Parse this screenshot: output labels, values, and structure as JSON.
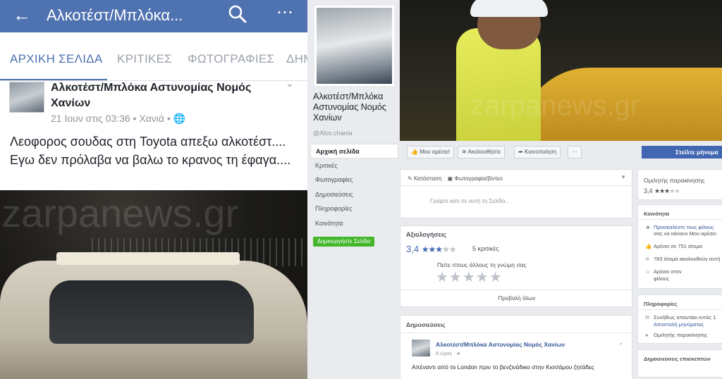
{
  "mobile": {
    "header_title": "Αλκοτέστ/Μπλόκα...",
    "tabs": [
      "ΑΡΧΙΚΗ ΣΕΛΙΔΑ",
      "ΚΡΙΤΙΚΕΣ",
      "ΦΩΤΟΓΡΑΦΙΕΣ",
      "ΔΗΜ"
    ],
    "page_name": "Αλκοτέστ/Μπλόκα Αστυνομίας Νομός Χανίων",
    "meta_date": "21 Ιουν στις 03:36",
    "meta_location": "Χανιά",
    "post_text": "Λεοφορος σουδας στη  Toyota απεξω αλκοτέστ.... Εγω δεν πρόλαβα να βαλω το κρανος τη έφαγα....",
    "photo_watermark": "zarpanews.gr",
    "accent": "#4f72b0"
  },
  "desktop": {
    "page_name": "Αλκοτέστ/Μπλόκα Αστυνομίας Νομός Χανίων",
    "handle": "@Alco.chania",
    "nav": [
      "Αρχική σελίδα",
      "Κριτικές",
      "Φωτογραφίες",
      "Δημοσιεύσεις",
      "Πληροφορίες",
      "Κοινότητα"
    ],
    "create_page": "Δημιουργήστε Σελίδα",
    "cover_watermark": "zarpanews.gr",
    "actions": {
      "like": "Μου αρέσει!",
      "follow": "Ακολουθήστε",
      "share": "Κοινοποίηση",
      "more": "···",
      "send": "Στείλτε μήνυμα"
    },
    "composer": {
      "status": "Κατάσταση",
      "photo": "Φωτογραφία/βίντεο",
      "placeholder": "Γράψτε κάτι σε αυτή τη Σελίδα..."
    },
    "reviews": {
      "title": "Αξιολογήσεις",
      "score": "3,4",
      "count": "5 κριτικές",
      "prompt": "Πείτε στους άλλους τη γνώμη σας",
      "see_all": "Προβολή όλων"
    },
    "posts": {
      "title": "Δημοσιεύσεις",
      "name": "Αλκοτέστ/Μπλόκα Αστυνομίας Νομός Χανίων",
      "time": "8 ώρες",
      "text": "Απέναντι από το London πριν το βενζινάδικο στην Κισσάμου ζητάδες"
    },
    "right": {
      "response_title": "Ομιλητής παρακίνησης",
      "response_score": "3,4",
      "community_title": "Κοινότητα",
      "invite": "Προσκαλέστε τους φίλους",
      "invite2": "σας να κάνουν Μου αρέσει",
      "likes": "Αρέσει σε 751 άτομα",
      "follows": "783 άτομα ακολουθούν αυτή",
      "friends1": "Αρέσει στον",
      "friends2": "φίλους",
      "info_title": "Πληροφορίες",
      "reply1": "Συνήθως απαντάει εντός 1",
      "reply2": "Αποστολή μηνύματος",
      "talk": "Ομιλητής παρακίνησης",
      "visits_title": "Δημοσιεύσεις επισκεπτών"
    },
    "accent": "#4267b2",
    "create_color": "#42b72a"
  }
}
